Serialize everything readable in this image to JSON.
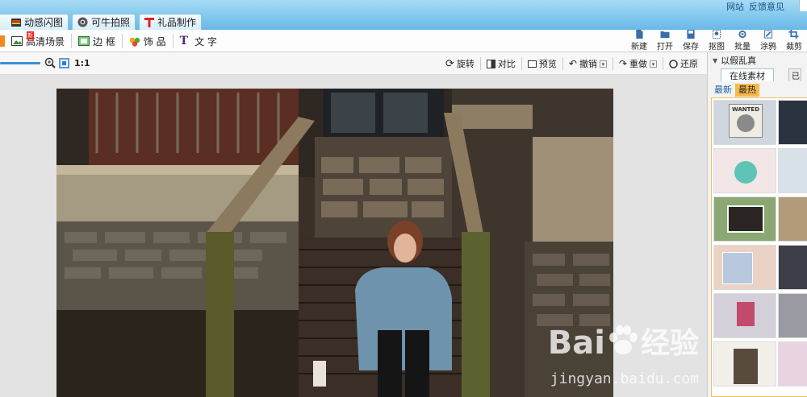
{
  "top_links": [
    "网站",
    "反馈意见"
  ],
  "tabs": [
    {
      "label": "动感闪图",
      "icon": "film-icon"
    },
    {
      "label": "可牛拍照",
      "icon": "camera-icon"
    },
    {
      "label": "礼品制作",
      "icon": "gift-icon"
    }
  ],
  "tools": [
    {
      "label": "高清场景",
      "icon": "scene-icon",
      "badge": "新"
    },
    {
      "label": "边 框",
      "icon": "frame-icon"
    },
    {
      "label": "饰 品",
      "icon": "clover-icon"
    },
    {
      "label": "文 字",
      "icon": "text-icon"
    }
  ],
  "right_tools": [
    {
      "label": "新建",
      "icon": "new-file-icon"
    },
    {
      "label": "打开",
      "icon": "folder-icon"
    },
    {
      "label": "保存",
      "icon": "save-icon"
    },
    {
      "label": "抠图",
      "icon": "cutout-icon"
    },
    {
      "label": "批量",
      "icon": "batch-icon"
    },
    {
      "label": "涂鸦",
      "icon": "doodle-icon"
    },
    {
      "label": "裁剪",
      "icon": "crop-icon"
    }
  ],
  "zoom": {
    "ratio_label": "1:1",
    "level": 1.0
  },
  "sub_tools": [
    {
      "label": "旋转",
      "icon": "rotate-icon",
      "dropdown": false
    },
    {
      "label": "对比",
      "icon": "compare-icon",
      "dropdown": false
    },
    {
      "label": "预览",
      "icon": "preview-icon",
      "dropdown": false
    },
    {
      "label": "撤销",
      "icon": "undo-icon",
      "dropdown": true
    },
    {
      "label": "重做",
      "icon": "redo-icon",
      "dropdown": true
    },
    {
      "label": "还原",
      "icon": "restore-icon",
      "dropdown": false
    }
  ],
  "panel": {
    "title": "以假乱真",
    "tab_online": "在线素材",
    "tab_other": "已",
    "sub_new": "最新",
    "sub_hot": "最热",
    "thumb_text": "WANTED"
  },
  "watermark": {
    "brand": "Bai",
    "brand_cn": "经验",
    "url": "jingyan.baidu.com"
  },
  "colors": {
    "titlebar": "#7fc6ee",
    "accent": "#3b8fd9",
    "hot_tab": "#f6b94a"
  }
}
